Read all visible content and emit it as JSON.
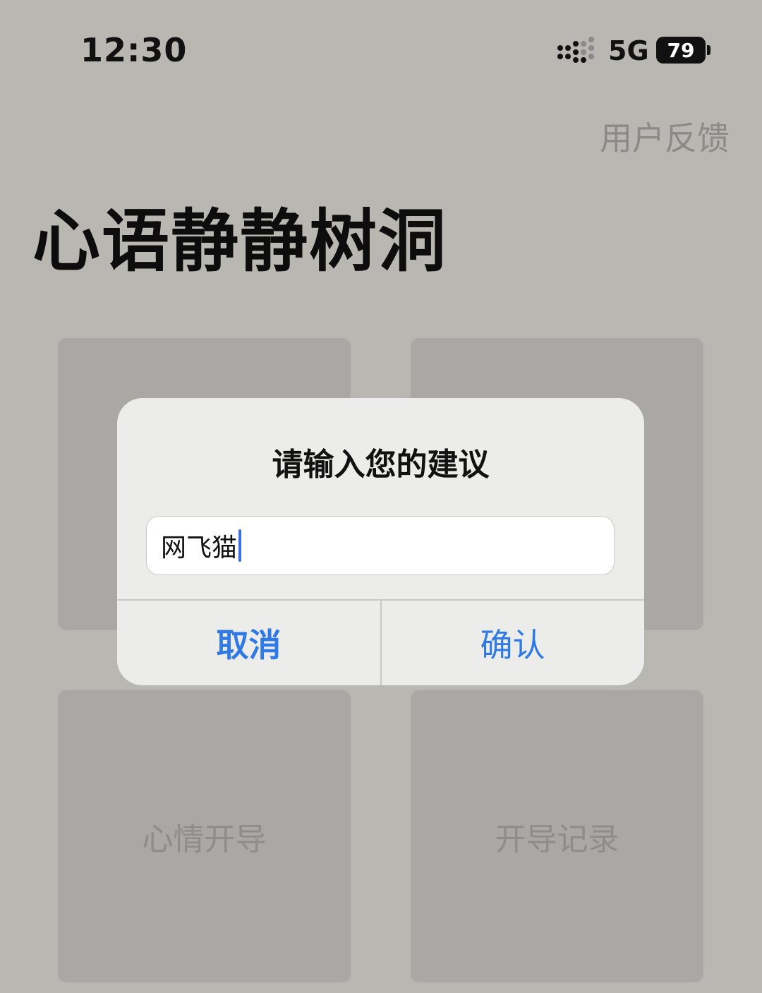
{
  "status_bar": {
    "time": "12:30",
    "network": "5G",
    "battery": "79"
  },
  "header": {
    "feedback_label": "用户反馈",
    "title": "心语静静树洞"
  },
  "tiles": [
    {
      "label": ""
    },
    {
      "label": ""
    },
    {
      "label": "心情开导"
    },
    {
      "label": "开导记录"
    }
  ],
  "dialog": {
    "title": "请输入您的建议",
    "input_value": "网飞猫",
    "cancel_label": "取消",
    "confirm_label": "确认"
  },
  "colors": {
    "accent": "#2f7ae5",
    "background": "#b8b7b2"
  },
  "icons": [
    "signal-icon",
    "battery-icon"
  ]
}
